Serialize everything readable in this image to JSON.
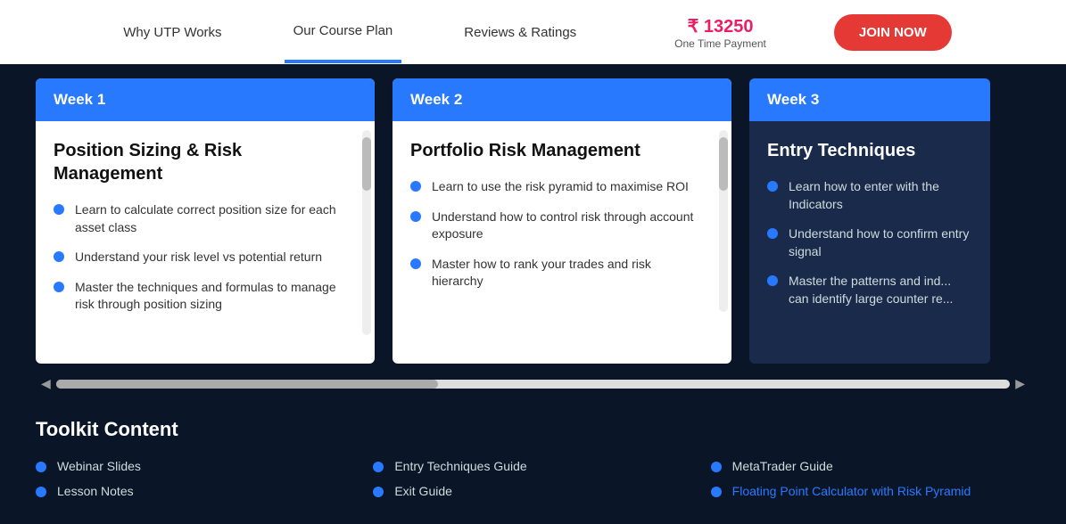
{
  "nav": {
    "items": [
      {
        "label": "Why UTP Works",
        "active": false
      },
      {
        "label": "Our Course Plan",
        "active": true
      },
      {
        "label": "Reviews & Ratings",
        "active": false
      }
    ],
    "price": {
      "currency": "₹",
      "amount": "13250",
      "label": "One Time Payment"
    },
    "join_button": "JOIN NOW"
  },
  "weeks": [
    {
      "id": "week1",
      "header": "Week 1",
      "title": "Position Sizing & Risk Management",
      "bullets": [
        "Learn to calculate correct position size for each asset class",
        "Understand your risk level vs potential return",
        "Master the techniques and formulas to manage risk through position sizing"
      ],
      "dark": false
    },
    {
      "id": "week2",
      "header": "Week 2",
      "title": "Portfolio Risk Management",
      "bullets": [
        "Learn to use the risk pyramid to maximise ROI",
        "Understand how to control risk through account exposure",
        "Master how to rank your trades and risk hierarchy"
      ],
      "dark": false
    },
    {
      "id": "week3",
      "header": "Week 3",
      "title": "Entry Techniques",
      "bullets": [
        "Learn how to enter with the Indicators",
        "Understand how to confirm entry signal",
        "Master the patterns and ind... can identify large counter re..."
      ],
      "dark": true
    }
  ],
  "toolkit": {
    "title": "Toolkit Content",
    "items": [
      {
        "label": "Webinar Slides",
        "highlight": false
      },
      {
        "label": "Entry Techniques Guide",
        "highlight": false
      },
      {
        "label": "MetaTrader Guide",
        "highlight": false
      },
      {
        "label": "Lesson Notes",
        "highlight": false
      },
      {
        "label": "Exit Guide",
        "highlight": false
      },
      {
        "label": "Floating Point Calculator with Risk Pyramid",
        "highlight": true
      }
    ]
  }
}
